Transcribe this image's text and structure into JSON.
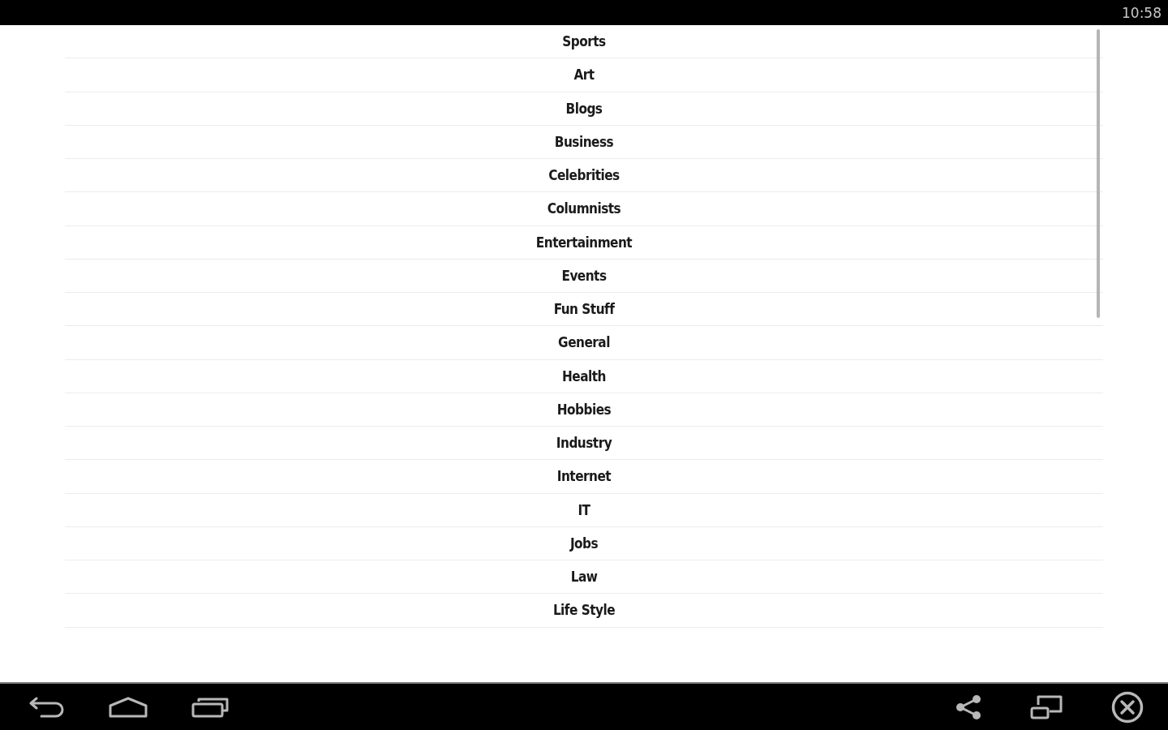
{
  "status_bar": {
    "time": "10:58"
  },
  "list": {
    "items": [
      "Sports",
      "Art",
      "Blogs",
      "Business",
      "Celebrities",
      "Columnists",
      "Entertainment",
      "Events",
      "Fun Stuff",
      "General",
      "Health",
      "Hobbies",
      "Industry",
      "Internet",
      "IT",
      "Jobs",
      "Law",
      "Life Style"
    ]
  }
}
